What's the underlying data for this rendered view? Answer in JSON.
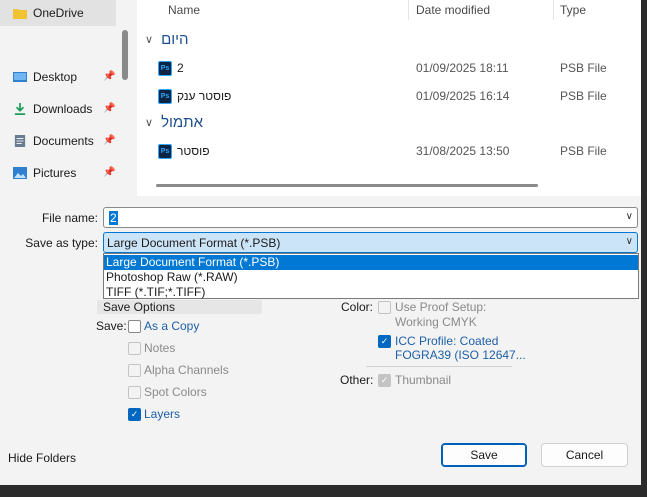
{
  "nav": {
    "items": [
      {
        "label": "OneDrive",
        "icon": "folder-icon",
        "pinned": false
      },
      {
        "label": "Desktop",
        "icon": "desktop-icon",
        "pinned": true
      },
      {
        "label": "Downloads",
        "icon": "download-icon",
        "pinned": true
      },
      {
        "label": "Documents",
        "icon": "documents-icon",
        "pinned": true
      },
      {
        "label": "Pictures",
        "icon": "pictures-icon",
        "pinned": true
      }
    ]
  },
  "columns": {
    "name": "Name",
    "date": "Date modified",
    "type": "Type"
  },
  "groups": [
    {
      "label": "היום",
      "files": [
        {
          "name": "2",
          "date": "01/09/2025 18:11",
          "type": "PSB File"
        },
        {
          "name": "פוסטר ענק",
          "date": "01/09/2025 16:14",
          "type": "PSB File"
        }
      ]
    },
    {
      "label": "אתמול",
      "files": [
        {
          "name": "פוסטר",
          "date": "31/08/2025 13:50",
          "type": "PSB File"
        }
      ]
    }
  ],
  "form": {
    "filename_label": "File name:",
    "filename_value": "2",
    "savetype_label": "Save as type:",
    "savetype_value": "Large Document Format (*.PSB)",
    "savetype_options": [
      "Large Document Format (*.PSB)",
      "Photoshop Raw (*.RAW)",
      "TIFF (*.TIF;*.TIFF)"
    ]
  },
  "options": {
    "title": "Save Options",
    "save_label": "Save:",
    "as_copy": "As a Copy",
    "notes": "Notes",
    "alpha": "Alpha Channels",
    "spot": "Spot Colors",
    "layers": "Layers",
    "color_label": "Color:",
    "proof_line1": "Use Proof Setup:",
    "proof_line2": "Working CMYK",
    "icc_line1": "ICC Profile:  Coated",
    "icc_line2": "FOGRA39 (ISO 12647...",
    "other_label": "Other:",
    "thumbnail": "Thumbnail"
  },
  "footer": {
    "hide_folders": "Hide Folders",
    "save": "Save",
    "cancel": "Cancel"
  },
  "colors": {
    "accent": "#0078d4",
    "group_text": "#1e4e8c"
  }
}
